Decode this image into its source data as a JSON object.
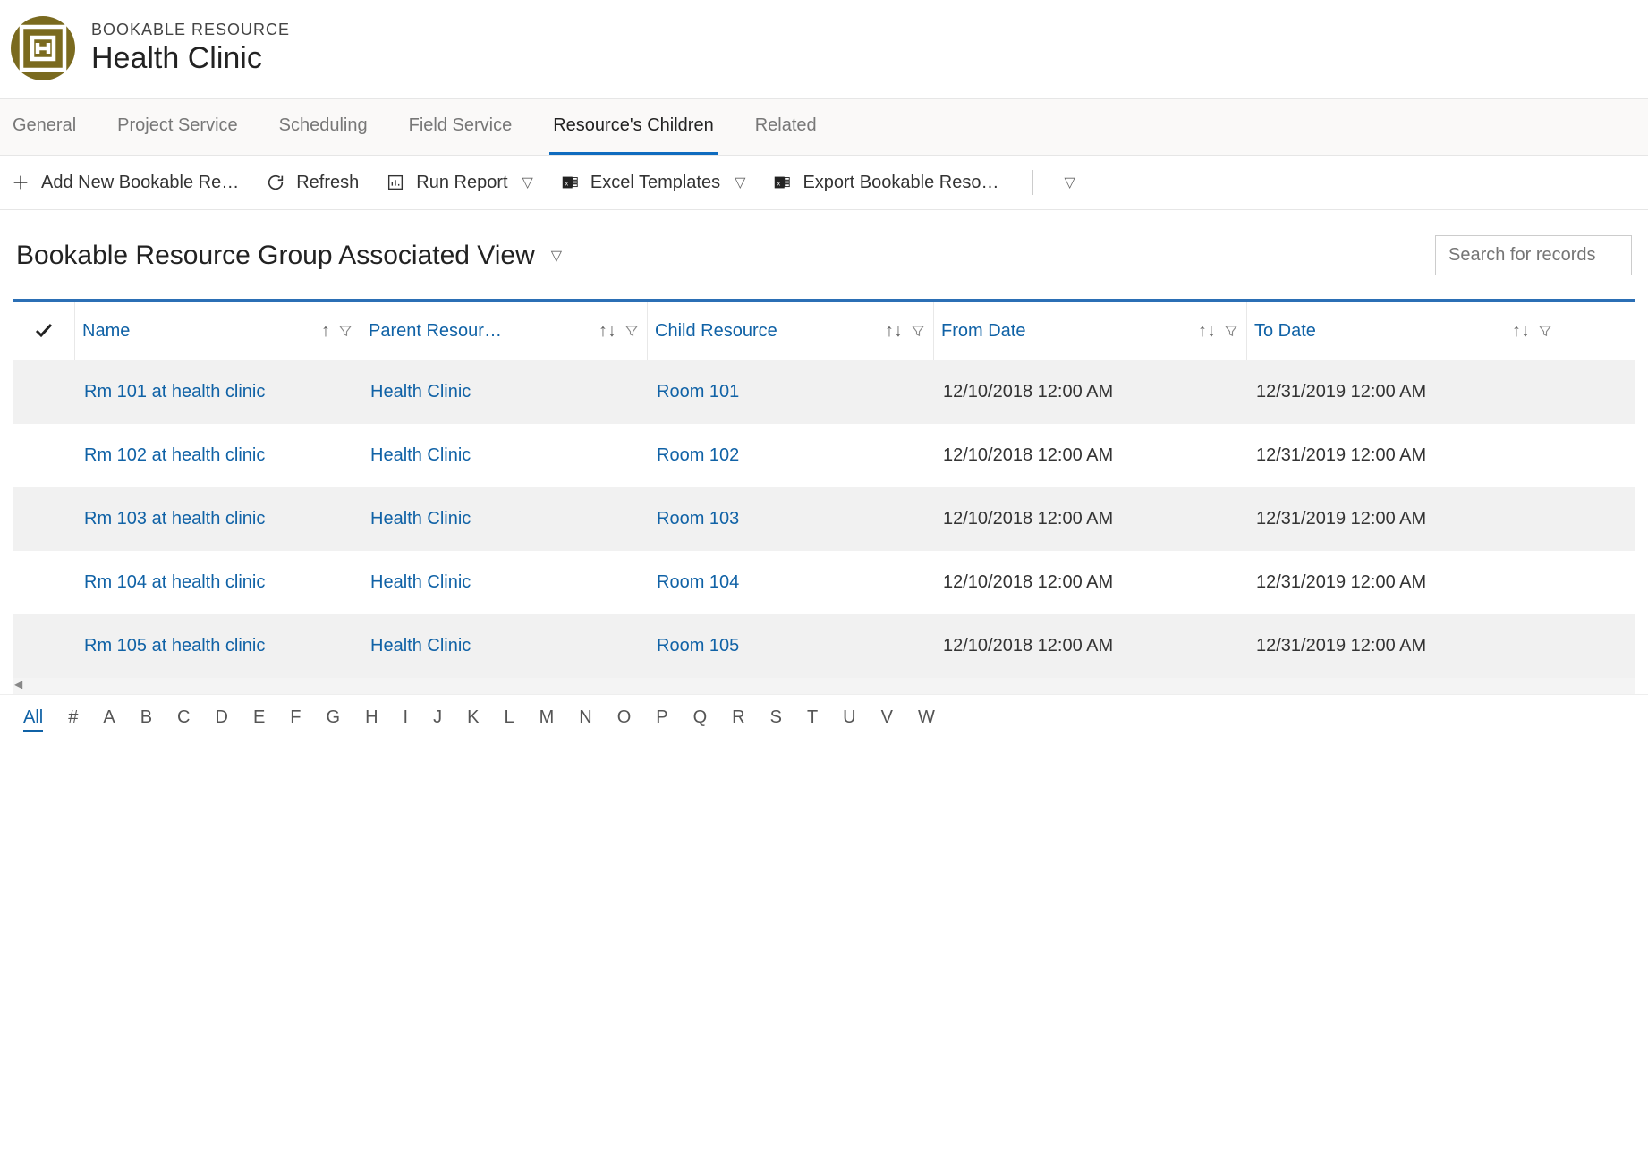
{
  "header": {
    "type_label": "BOOKABLE RESOURCE",
    "title": "Health Clinic"
  },
  "tabs": [
    {
      "label": "General",
      "active": false
    },
    {
      "label": "Project Service",
      "active": false
    },
    {
      "label": "Scheduling",
      "active": false
    },
    {
      "label": "Field Service",
      "active": false
    },
    {
      "label": "Resource's Children",
      "active": true
    },
    {
      "label": "Related",
      "active": false
    }
  ],
  "commands": {
    "add_new": "Add New Bookable Re…",
    "refresh": "Refresh",
    "run_report": "Run Report",
    "excel_templates": "Excel Templates",
    "export": "Export Bookable Reso…"
  },
  "view": {
    "title": "Bookable Resource Group Associated View",
    "search_placeholder": "Search for records"
  },
  "columns": [
    {
      "label": "Name",
      "sort": "up"
    },
    {
      "label": "Parent Resour…",
      "sort": "updown"
    },
    {
      "label": "Child Resource",
      "sort": "updown"
    },
    {
      "label": "From Date",
      "sort": "updown"
    },
    {
      "label": "To Date",
      "sort": "updown"
    }
  ],
  "rows": [
    {
      "name": "Rm 101 at health clinic",
      "parent": "Health Clinic",
      "child": "Room 101",
      "from": "12/10/2018 12:00 AM",
      "to": "12/31/2019 12:00 AM"
    },
    {
      "name": "Rm 102 at health clinic",
      "parent": "Health Clinic",
      "child": "Room 102",
      "from": "12/10/2018 12:00 AM",
      "to": "12/31/2019 12:00 AM"
    },
    {
      "name": "Rm 103 at health clinic",
      "parent": "Health Clinic",
      "child": "Room 103",
      "from": "12/10/2018 12:00 AM",
      "to": "12/31/2019 12:00 AM"
    },
    {
      "name": "Rm 104 at health clinic",
      "parent": "Health Clinic",
      "child": "Room 104",
      "from": "12/10/2018 12:00 AM",
      "to": "12/31/2019 12:00 AM"
    },
    {
      "name": "Rm 105 at health clinic",
      "parent": "Health Clinic",
      "child": "Room 105",
      "from": "12/10/2018 12:00 AM",
      "to": "12/31/2019 12:00 AM"
    }
  ],
  "alpha": [
    "All",
    "#",
    "A",
    "B",
    "C",
    "D",
    "E",
    "F",
    "G",
    "H",
    "I",
    "J",
    "K",
    "L",
    "M",
    "N",
    "O",
    "P",
    "Q",
    "R",
    "S",
    "T",
    "U",
    "V",
    "W"
  ]
}
